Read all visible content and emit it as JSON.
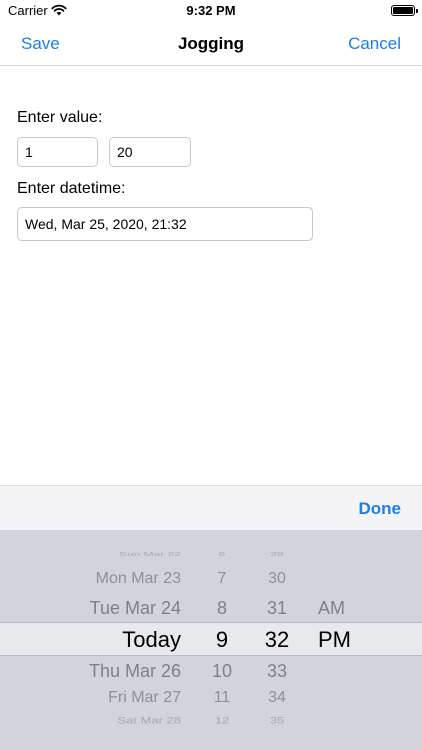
{
  "status_bar": {
    "carrier": "Carrier",
    "time": "9:32 PM"
  },
  "nav": {
    "left_button": "Save",
    "title": "Jogging",
    "right_button": "Cancel"
  },
  "form": {
    "value_label": "Enter value:",
    "value_1": "1",
    "value_2": "20",
    "datetime_label": "Enter datetime:",
    "datetime_value": "Wed, Mar 25, 2020, 21:32"
  },
  "toolbar": {
    "done_label": "Done"
  },
  "picker": {
    "rows": [
      {
        "date": "Sun Mar 22",
        "hour": "6",
        "minute": "29",
        "ampm": ""
      },
      {
        "date": "Mon Mar 23",
        "hour": "7",
        "minute": "30",
        "ampm": ""
      },
      {
        "date": "Tue Mar 24",
        "hour": "8",
        "minute": "31",
        "ampm": "AM"
      },
      {
        "date": "Today",
        "hour": "9",
        "minute": "32",
        "ampm": "PM"
      },
      {
        "date": "Thu Mar 26",
        "hour": "10",
        "minute": "33",
        "ampm": ""
      },
      {
        "date": "Fri Mar 27",
        "hour": "11",
        "minute": "34",
        "ampm": ""
      },
      {
        "date": "Sat Mar 28",
        "hour": "12",
        "minute": "35",
        "ampm": ""
      }
    ]
  },
  "colors": {
    "accent": "#1a80e6",
    "picker_bg": "#d1d4da",
    "toolbar_bg": "#f4f4f6"
  },
  "icons": {
    "wifi": "wifi-icon",
    "battery": "battery-icon"
  }
}
